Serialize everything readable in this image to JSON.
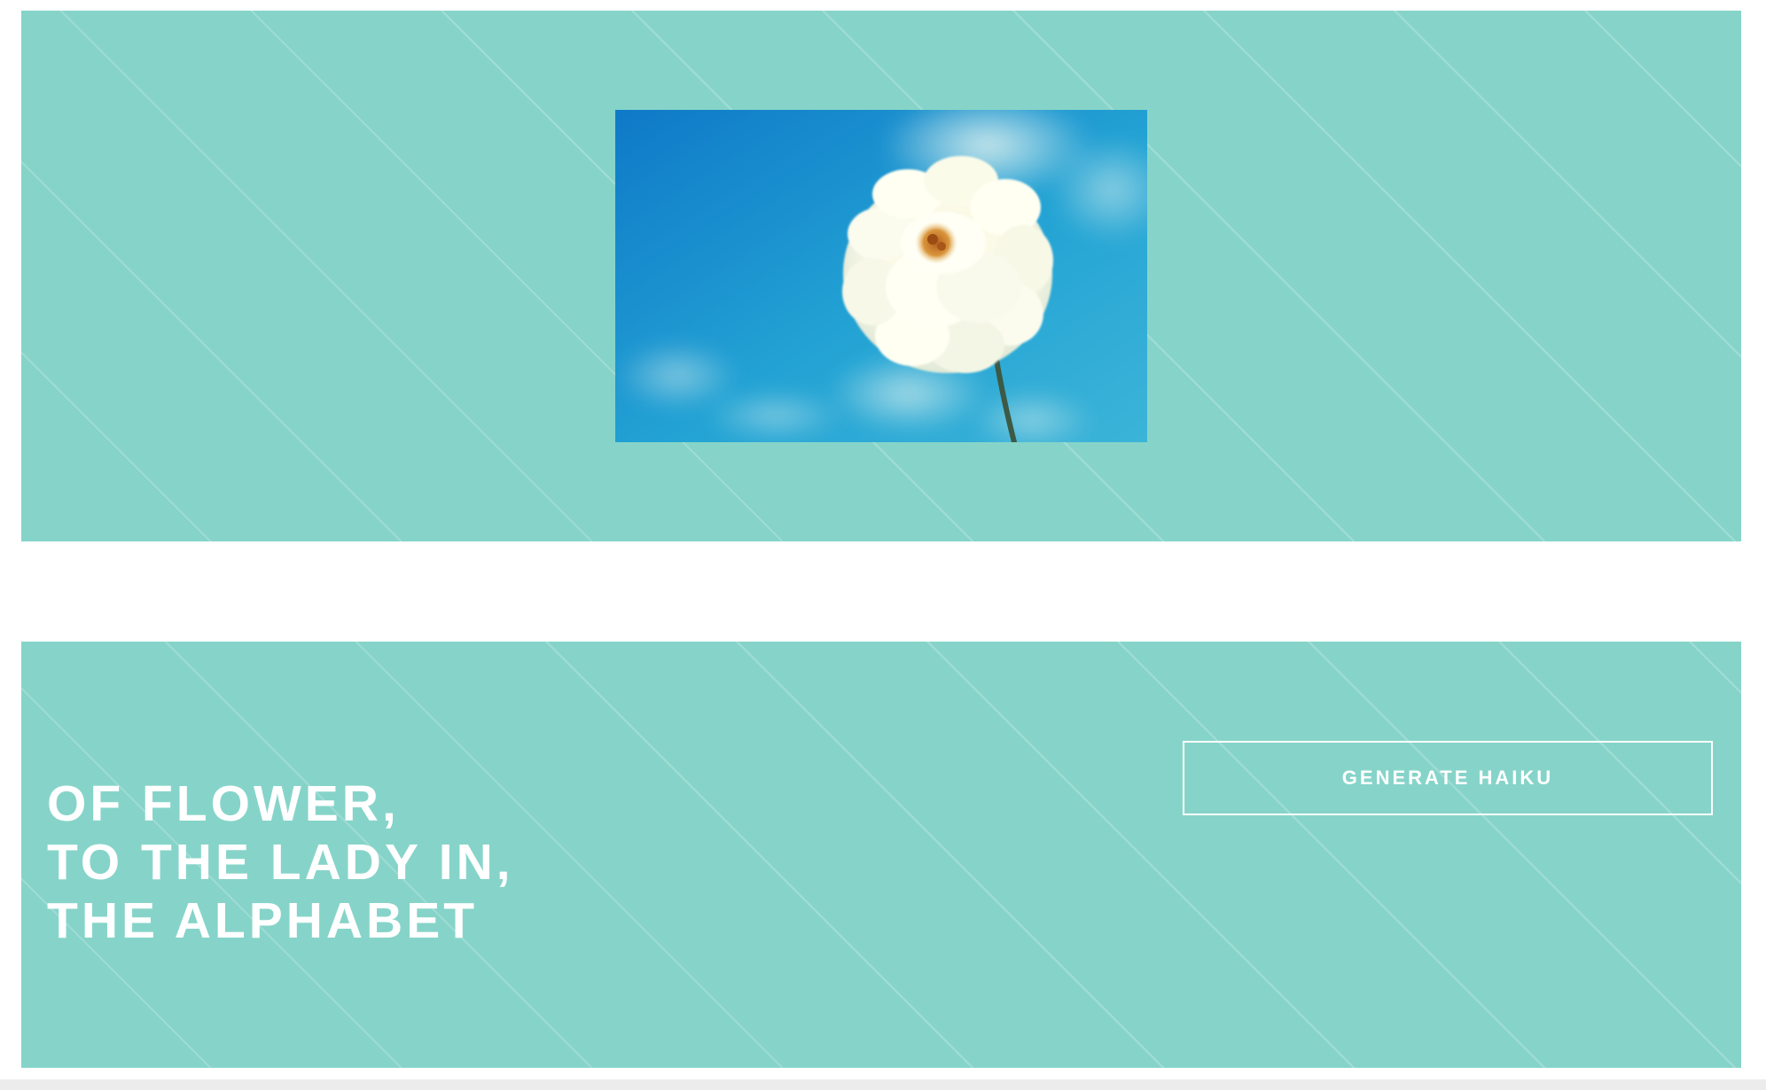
{
  "image_panel": {
    "photo_alt": "White flower against a blue sky"
  },
  "haiku": {
    "lines": [
      "OF FLOWER,",
      "TO THE LADY IN,",
      "THE ALPHABET"
    ]
  },
  "actions": {
    "generate_label": "GENERATE HAIKU"
  },
  "colors": {
    "panel_background": "#86d4c9",
    "text": "#ffffff",
    "button_border": "#ffffff",
    "page_background": "#ffffff"
  },
  "icons": [
    "flower-photo"
  ]
}
